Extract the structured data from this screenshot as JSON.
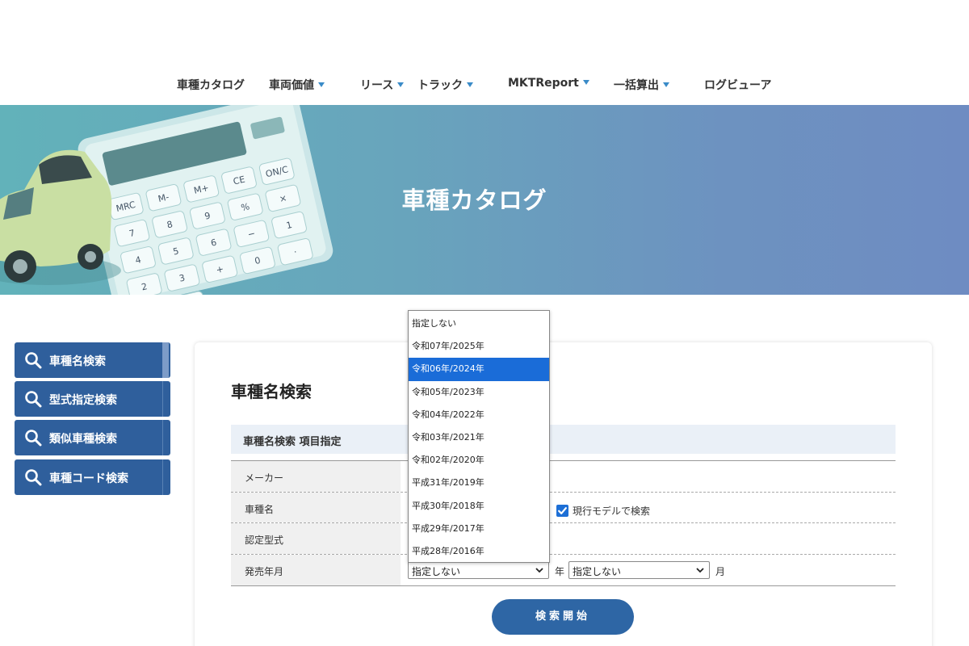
{
  "nav": {
    "items": [
      {
        "label": "車種カタログ"
      },
      {
        "label": "車両価値"
      },
      {
        "label": "リース"
      },
      {
        "label": "トラック"
      },
      {
        "label": "MKTReport"
      },
      {
        "label": "一括算出"
      },
      {
        "label": "ログビューア"
      }
    ]
  },
  "hero": {
    "title": "車種カタログ",
    "calculator_keys": [
      "MRC",
      "M-",
      "M+",
      "CE",
      "ON/C",
      "7",
      "8",
      "9",
      "%",
      "×",
      "4",
      "5",
      "6",
      "−",
      "1",
      "2",
      "3",
      "+",
      "0",
      "·",
      "+/-",
      "="
    ]
  },
  "sidebar": {
    "items": [
      {
        "label": "車種名検索"
      },
      {
        "label": "型式指定検索"
      },
      {
        "label": "類似車種検索"
      },
      {
        "label": "車種コード検索"
      }
    ]
  },
  "main": {
    "title": "車種名検索",
    "section_label": "車種名検索 項目指定",
    "fields": {
      "maker_label": "メーカー",
      "model_label": "車種名",
      "cert_label": "認定型式",
      "release_label": "発売年月"
    },
    "current_model_label": "現行モデルで検索",
    "current_model_checked": true,
    "year_select_value": "指定しない",
    "year_unit": "年",
    "month_select_value": "指定しない",
    "month_unit": "月",
    "search_button": "検索開始"
  },
  "year_dropdown": {
    "options": [
      "指定しない",
      "令和07年/2025年",
      "令和06年/2024年",
      "令和05年/2023年",
      "令和04年/2022年",
      "令和03年/2021年",
      "令和02年/2020年",
      "平成31年/2019年",
      "平成30年/2018年",
      "平成29年/2017年",
      "平成28年/2016年"
    ],
    "highlighted": "令和06年/2024年"
  },
  "colors": {
    "nav_caret": "#3a8bc8",
    "sidebar_bg": "#2f5f9c",
    "button_bg": "#2e66a5",
    "highlight": "#1a6cd8"
  }
}
